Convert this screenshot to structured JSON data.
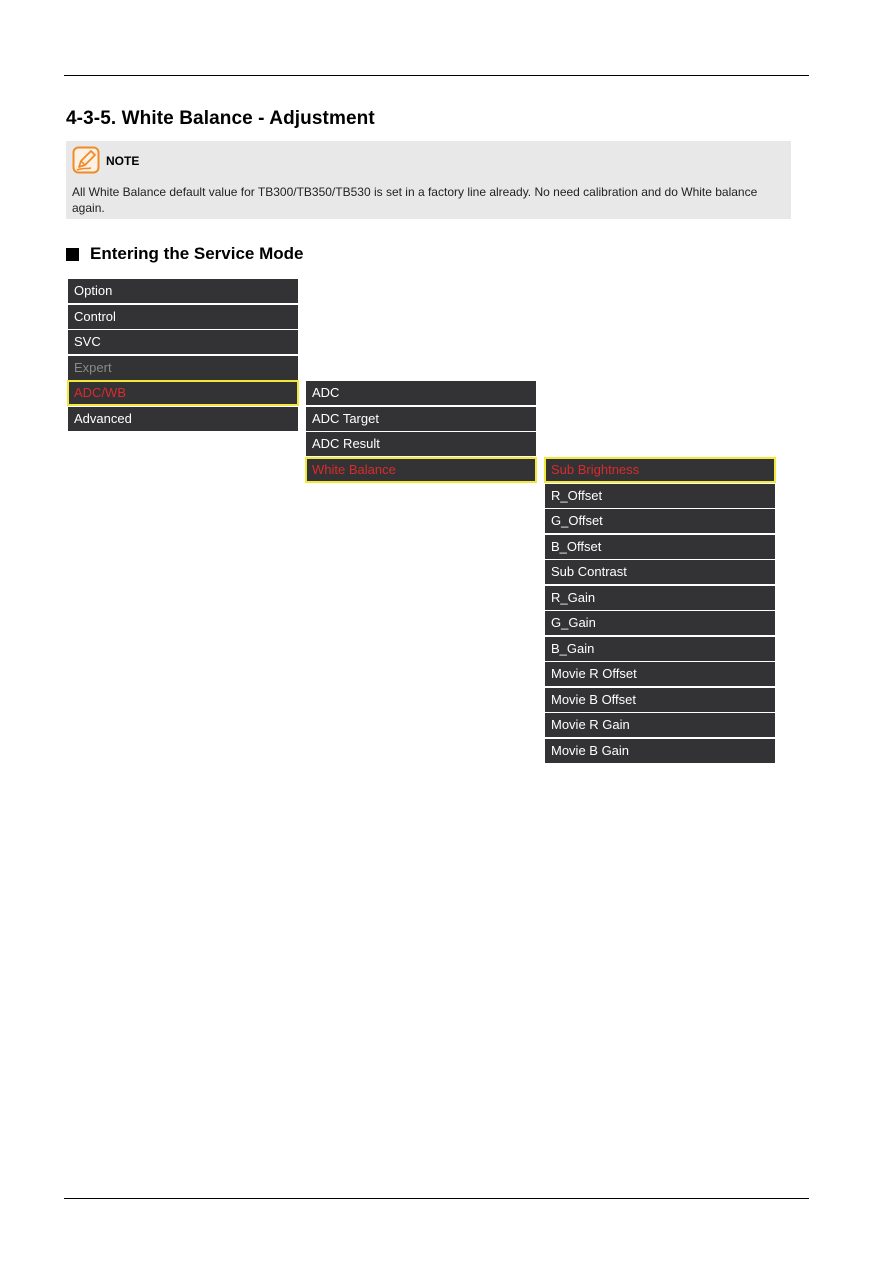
{
  "section": {
    "title": "4-3-5. White Balance - Adjustment"
  },
  "note": {
    "icon": "note-pencil-icon",
    "label": "NOTE",
    "text": "All White Balance default value for TB300/TB350/TB530 is set in a factory line already. No need calibration and do White balance again."
  },
  "subheading": {
    "bullet": "black-square",
    "text": "Entering the Service Mode"
  },
  "colors": {
    "menu_bg": "#333335",
    "selected_text": "#d92b2b",
    "selected_border": "#f2e83a",
    "disabled_text": "#8a8a8a",
    "note_bg": "#e8e8e8",
    "note_icon": "#f08a2a"
  },
  "menus": {
    "main": [
      {
        "label": "Option",
        "state": "normal"
      },
      {
        "label": "Control",
        "state": "normal"
      },
      {
        "label": "SVC",
        "state": "normal"
      },
      {
        "label": "Expert",
        "state": "disabled"
      },
      {
        "label": "ADC/WB",
        "state": "selected"
      },
      {
        "label": "Advanced",
        "state": "normal"
      }
    ],
    "adc_wb": [
      {
        "label": "ADC",
        "state": "normal"
      },
      {
        "label": "ADC Target",
        "state": "normal"
      },
      {
        "label": "ADC Result",
        "state": "normal"
      },
      {
        "label": "White Balance",
        "state": "selected"
      }
    ],
    "white_balance": [
      {
        "label": "Sub Brightness",
        "state": "selected"
      },
      {
        "label": "R_Offset",
        "state": "normal"
      },
      {
        "label": "G_Offset",
        "state": "normal"
      },
      {
        "label": "B_Offset",
        "state": "normal"
      },
      {
        "label": "Sub Contrast",
        "state": "normal"
      },
      {
        "label": "R_Gain",
        "state": "normal"
      },
      {
        "label": "G_Gain",
        "state": "normal"
      },
      {
        "label": "B_Gain",
        "state": "normal"
      },
      {
        "label": "Movie R Offset",
        "state": "normal"
      },
      {
        "label": "Movie B Offset",
        "state": "normal"
      },
      {
        "label": "Movie R Gain",
        "state": "normal"
      },
      {
        "label": "Movie B Gain",
        "state": "normal"
      }
    ]
  }
}
